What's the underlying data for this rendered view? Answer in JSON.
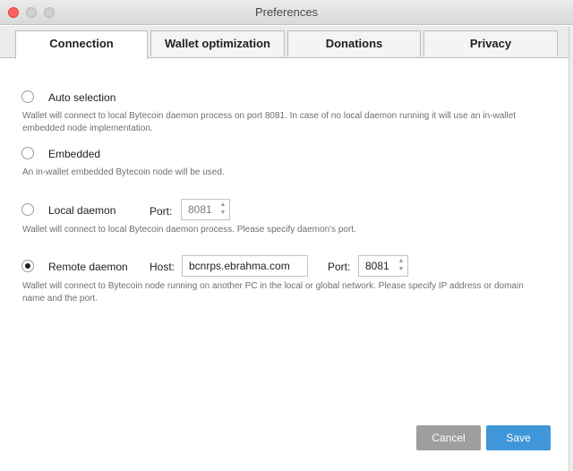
{
  "window": {
    "title": "Preferences"
  },
  "tabs": [
    {
      "label": "Connection",
      "active": true
    },
    {
      "label": "Wallet optimization",
      "active": false
    },
    {
      "label": "Donations",
      "active": false
    },
    {
      "label": "Privacy",
      "active": false
    }
  ],
  "options": {
    "auto": {
      "label": "Auto selection",
      "selected": false,
      "description": "Wallet will connect to local Bytecoin daemon process on port 8081. In case of no local daemon running it will use an in-wallet embedded node implementation."
    },
    "embedded": {
      "label": "Embedded",
      "selected": false,
      "description": "An in-wallet embedded Bytecoin node will be used."
    },
    "local": {
      "label": "Local daemon",
      "selected": false,
      "port_label": "Port:",
      "port_value": "8081",
      "description": "Wallet will connect to local Bytecoin daemon process. Please specify daemon's port."
    },
    "remote": {
      "label": "Remote daemon",
      "selected": true,
      "host_label": "Host:",
      "host_value": "bcnrps.ebrahma.com",
      "port_label": "Port:",
      "port_value": "8081",
      "description": "Wallet will connect to Bytecoin node running on another PC in the local or global network. Please specify IP address or domain name and the port."
    }
  },
  "buttons": {
    "cancel": "Cancel",
    "save": "Save"
  },
  "icons": {
    "stepper_up": "▲",
    "stepper_down": "▼"
  },
  "colors": {
    "save": "#3f96d8",
    "cancel": "#9e9e9e",
    "close": "#fc605b"
  }
}
